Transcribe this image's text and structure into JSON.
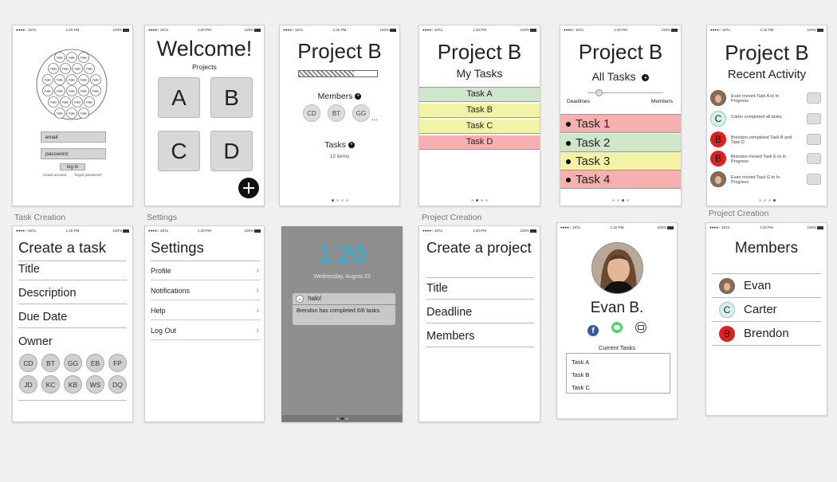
{
  "status_bar": {
    "carrier": "●●●●○ 187a",
    "time": "1:20 PM",
    "battery": "100%"
  },
  "captions": [
    "Task Creation",
    "Settings",
    "Project Creation",
    "Project Creation"
  ],
  "login": {
    "logo_word": "halo",
    "email_placeholder": "email",
    "password_placeholder": "password",
    "login_button": "log in",
    "create_account": "create account",
    "forgot_password": "forgot password?"
  },
  "welcome": {
    "title": "Welcome!",
    "subtitle": "Projects",
    "projects": [
      "A",
      "B",
      "C",
      "D"
    ],
    "add_icon": "plus-icon"
  },
  "project_overview": {
    "title": "Project B",
    "progress": 0.7,
    "members_label": "Members",
    "members": [
      "CD",
      "BT",
      "GG"
    ],
    "more": "...",
    "tasks_label": "Tasks",
    "tasks_count": "12 items"
  },
  "my_tasks": {
    "title": "Project B",
    "subtitle": "My Tasks",
    "tasks": [
      {
        "label": "Task A",
        "color": "#cfe6cb"
      },
      {
        "label": "Task B",
        "color": "#f3f3a6"
      },
      {
        "label": "Task C",
        "color": "#f3f3a6"
      },
      {
        "label": "Task D",
        "color": "#f6b0b0"
      }
    ]
  },
  "all_tasks": {
    "title": "Project B",
    "subtitle": "All Tasks",
    "slider_left": "Deadlines",
    "slider_right": "Members",
    "slider_value": 0.15,
    "tasks": [
      {
        "label": "Task 1",
        "color": "#f6b0b0"
      },
      {
        "label": "Task 2",
        "color": "#cfe6cb"
      },
      {
        "label": "Task 3",
        "color": "#f3f3a6"
      },
      {
        "label": "Task 4",
        "color": "#f6b0b0"
      }
    ]
  },
  "recent_activity": {
    "title": "Project B",
    "subtitle": "Recent Activity",
    "items": [
      {
        "icon": "photo",
        "letter": "",
        "text": "Evan moved Task A to In Progress"
      },
      {
        "icon": "letter",
        "letter": "C",
        "text": "Carter completed all tasks"
      },
      {
        "icon": "letter-red",
        "letter": "B",
        "text": "Brendon completed Task B and Task D"
      },
      {
        "icon": "letter-red",
        "letter": "B",
        "text": "Brendon moved Task E to In Progress"
      },
      {
        "icon": "photo",
        "letter": "",
        "text": "Evan moved Task G to In Progress"
      }
    ]
  },
  "create_task": {
    "title": "Create a task",
    "fields": [
      "Title",
      "Description",
      "Due Date",
      "Owner"
    ],
    "owners": [
      "CD",
      "BT",
      "GG",
      "EB",
      "FP",
      "JD",
      "KC",
      "KB",
      "WS",
      "DQ"
    ]
  },
  "settings": {
    "title": "Settings",
    "items": [
      "Profile",
      "Notifications",
      "Help",
      "Log Out"
    ]
  },
  "lock_screen": {
    "time": "1:20",
    "date": "Wednesday, August 23",
    "notif_app": "halo!",
    "notif_body": "Brendon has completed 6/6 tasks."
  },
  "create_project": {
    "title": "Create a project",
    "fields": [
      "Title",
      "Deadline",
      "Members"
    ]
  },
  "profile": {
    "name": "Evan B.",
    "socials": [
      "facebook-icon",
      "message-icon",
      "mail-icon"
    ],
    "tasks_label": "Current Tasks",
    "tasks": [
      "Task A",
      "Task B",
      "Task C"
    ]
  },
  "members": {
    "title": "Members",
    "people": [
      {
        "name": "Evan",
        "icon": "photo",
        "letter": ""
      },
      {
        "name": "Carter",
        "icon": "letter",
        "letter": "C"
      },
      {
        "name": "Brendon",
        "icon": "letter-red",
        "letter": "B"
      }
    ]
  }
}
